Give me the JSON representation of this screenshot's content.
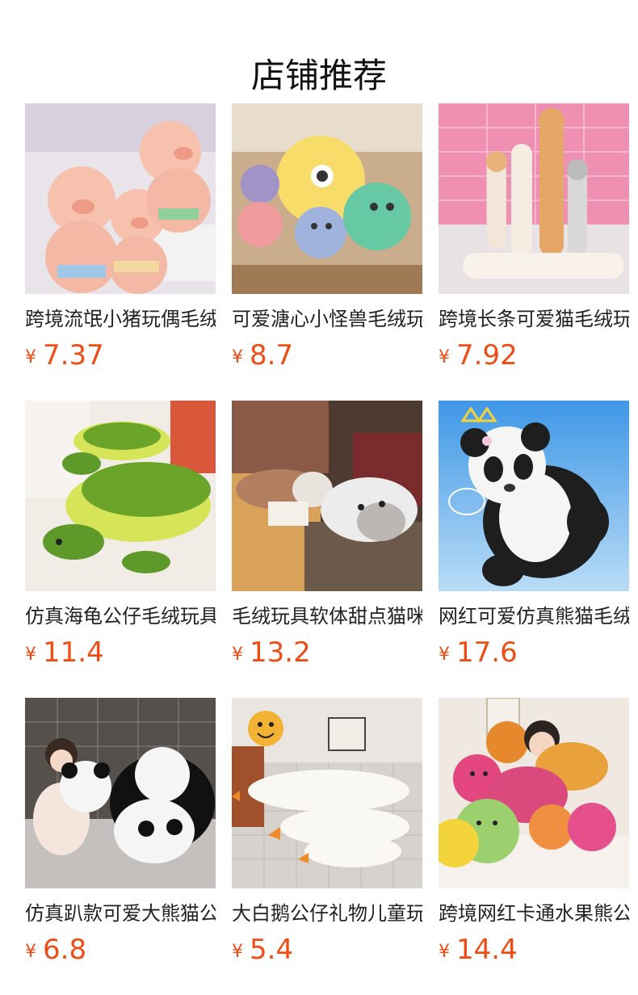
{
  "header": {
    "title": "店铺推荐"
  },
  "products": [
    {
      "name": "跨境流氓小猪玩偶毛绒",
      "currency": "¥",
      "price": "7.37",
      "image": "pig-plush-photo"
    },
    {
      "name": "可爱溏心小怪兽毛绒玩",
      "currency": "¥",
      "price": "8.7",
      "image": "monster-plush-photo"
    },
    {
      "name": "跨境长条可爱猫毛绒玩",
      "currency": "¥",
      "price": "7.92",
      "image": "long-cat-plush-photo"
    },
    {
      "name": "仿真海龟公仔毛绒玩具",
      "currency": "¥",
      "price": "11.4",
      "image": "turtle-plush-photo"
    },
    {
      "name": "毛绒玩具软体甜点猫咪",
      "currency": "¥",
      "price": "13.2",
      "image": "dessert-cat-plush-photo"
    },
    {
      "name": "网红可爱仿真熊猫毛绒",
      "currency": "¥",
      "price": "17.6",
      "image": "panda-plush-photo"
    },
    {
      "name": "仿真趴款可爱大熊猫公",
      "currency": "¥",
      "price": "6.8",
      "image": "lying-panda-plush-photo"
    },
    {
      "name": "大白鹅公仔礼物儿童玩",
      "currency": "¥",
      "price": "5.4",
      "image": "white-goose-plush-photo"
    },
    {
      "name": "跨境网红卡通水果熊公",
      "currency": "¥",
      "price": "14.4",
      "image": "fruit-bear-plush-photo"
    }
  ],
  "colors": {
    "price": "#ee4d16",
    "text": "#222222"
  }
}
